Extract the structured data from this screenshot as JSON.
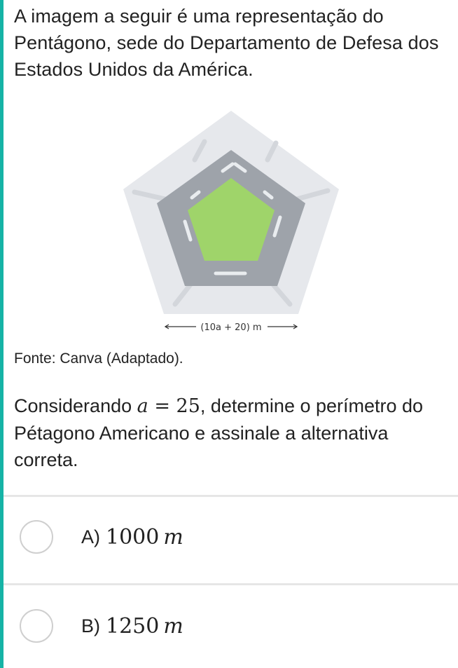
{
  "intro_text": "A imagem a seguir é uma representação do Pentágono, sede do Departamento de Defesa dos Estados Unidos da América.",
  "figure": {
    "dimension_label": "(10a + 20) m",
    "colors": {
      "outer": "#e6e8ec",
      "ring": "#9ea3aa",
      "roads": "#d3d6db",
      "courtyard": "#9fd46a",
      "dashes": "#e9ecef"
    }
  },
  "source_text": "Fonte: Canva (Adaptado).",
  "question": {
    "prefix": "Considerando ",
    "var": "a",
    "equals": " = ",
    "value": "25",
    "suffix": ", determine o perímetro do Pétagono Americano e assinale a alternativa correta."
  },
  "options": [
    {
      "letter": "A)",
      "value": "1000",
      "unit": "m"
    },
    {
      "letter": "B)",
      "value": "1250",
      "unit": "m"
    }
  ]
}
